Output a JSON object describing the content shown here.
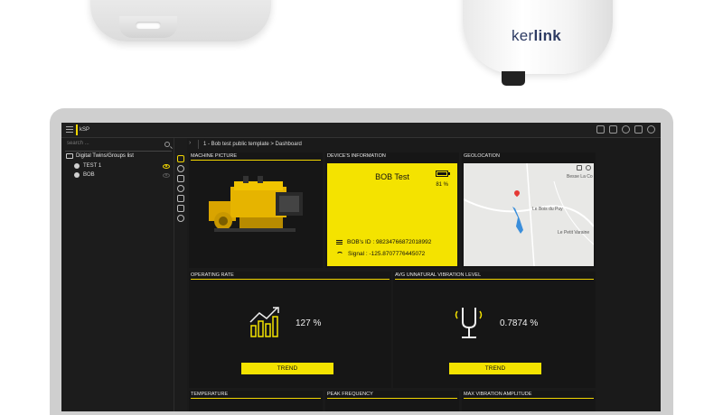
{
  "hardware": {
    "gateway_logo_light": "ker",
    "gateway_logo_bold": "link"
  },
  "app": {
    "logo_text": "kSP"
  },
  "sidebar": {
    "search_placeholder": "search ...",
    "tree_root_label": "Digital Twins/Groups list",
    "items": [
      {
        "label": "TEST 1",
        "visible": true
      },
      {
        "label": "BOB",
        "visible": false
      }
    ]
  },
  "breadcrumb": {
    "text": "1 - Bob test public template > Dashboard"
  },
  "panels": {
    "machine_picture": {
      "title": "MACHINE PICTURE"
    },
    "device_info": {
      "title": "DEVICE'S INFORMATION",
      "device_name": "BOB Test",
      "battery_percent": "81 %",
      "battery_level": 0.81,
      "id_text": "BOB's ID : 98234766872018992",
      "signal_text": "Signal : -125.8707776445072"
    },
    "geolocation": {
      "title": "GEOLOCATION",
      "labels": [
        "Besse La Co",
        "Le Bois du Puy",
        "Le Petit Varaine"
      ]
    },
    "operating_rate": {
      "title": "OPERATING RATE",
      "value": "127 %",
      "button": "TREND"
    },
    "vibration": {
      "title": "AVG UNNATURAL VIBRATION LEVEL",
      "value": "0.7874 %",
      "button": "TREND"
    },
    "temperature": {
      "title": "TEMPERATURE"
    },
    "peak_frequency": {
      "title": "PEAK FREQUENCY"
    },
    "max_vibration": {
      "title": "MAX VIBRATION AMPLITUDE"
    }
  },
  "colors": {
    "accent": "#f4e300",
    "background": "#1a1a1a",
    "panel": "#161616"
  }
}
